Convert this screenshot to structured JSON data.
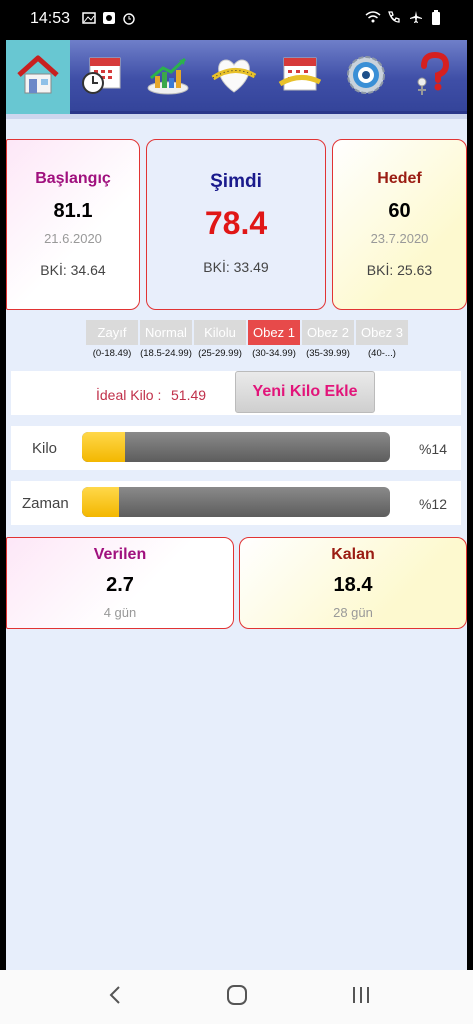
{
  "status_bar": {
    "time": "14:53",
    "left_icons": [
      "image-icon",
      "media-icon",
      "alarm-icon"
    ],
    "right_icons": [
      "wifi-icon",
      "call-icon",
      "airplane-icon",
      "battery-icon"
    ]
  },
  "toolbar": {
    "items": [
      {
        "icon": "home-icon",
        "active": true
      },
      {
        "icon": "calendar-clock-icon",
        "active": false
      },
      {
        "icon": "chart-icon",
        "active": false
      },
      {
        "icon": "weight-heart-icon",
        "active": false
      },
      {
        "icon": "calendar-tape-icon",
        "active": false
      },
      {
        "icon": "settings-icon",
        "active": false
      },
      {
        "icon": "help-icon",
        "active": false
      }
    ]
  },
  "cards": {
    "start": {
      "title": "Başlangıç",
      "value": "81.1",
      "date": "21.6.2020",
      "bmi": "BKİ: 34.64"
    },
    "now": {
      "title": "Şimdi",
      "value": "78.4",
      "bmi": "BKİ: 33.49"
    },
    "goal": {
      "title": "Hedef",
      "value": "60",
      "date": "23.7.2020",
      "bmi": "BKİ: 25.63"
    }
  },
  "colors": {
    "start_title": "#a0107e",
    "now_title": "#1a1a8c",
    "now_value": "#e01616",
    "goal_title": "#9a1c12",
    "card_border": "#e13333",
    "active_category": "#e74a4a"
  },
  "categories": [
    {
      "label": "Zayıf",
      "range": "(0-18.49)",
      "active": false
    },
    {
      "label": "Normal",
      "range": "(18.5-24.99)",
      "active": false
    },
    {
      "label": "Kilolu",
      "range": "(25-29.99)",
      "active": false
    },
    {
      "label": "Obez 1",
      "range": "(30-34.99)",
      "active": true
    },
    {
      "label": "Obez 2",
      "range": "(35-39.99)",
      "active": false
    },
    {
      "label": "Obez 3",
      "range": "(40-...)",
      "active": false
    }
  ],
  "ideal": {
    "label": "İdeal Kilo :",
    "value": "51.49",
    "button": "Yeni Kilo Ekle"
  },
  "progress": [
    {
      "label": "Kilo",
      "percent": 14,
      "text": "%14"
    },
    {
      "label": "Zaman",
      "percent": 12,
      "text": "%12"
    }
  ],
  "summary": {
    "given": {
      "title": "Verilen",
      "value": "2.7",
      "days": "4 gün"
    },
    "remaining": {
      "title": "Kalan",
      "value": "18.4",
      "days": "28 gün"
    }
  },
  "nav": {
    "icons": [
      "back-icon",
      "home-nav-icon",
      "recents-icon"
    ]
  }
}
